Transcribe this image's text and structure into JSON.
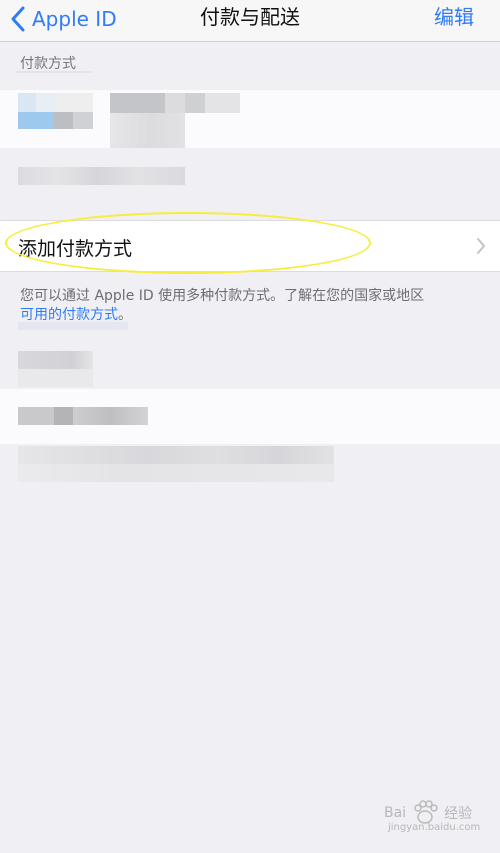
{
  "navbar": {
    "back_label": "Apple ID",
    "title": "付款与配送",
    "right_label": "编辑"
  },
  "payment_section": {
    "header": "付款方式",
    "add_payment_label": "添加付款方式"
  },
  "info": {
    "text": "您可以通过 Apple ID 使用多种付款方式。了解在您的国家或地区",
    "link_text": "可用的付款方式",
    "suffix": "。"
  },
  "watermark": {
    "left": "Bai",
    "right": "经验",
    "sub": "jingyan.baidu.com"
  },
  "colors": {
    "accent": "#2f7cf6",
    "background": "#efeff4",
    "highlight_ellipse": "#f5ee3c"
  }
}
